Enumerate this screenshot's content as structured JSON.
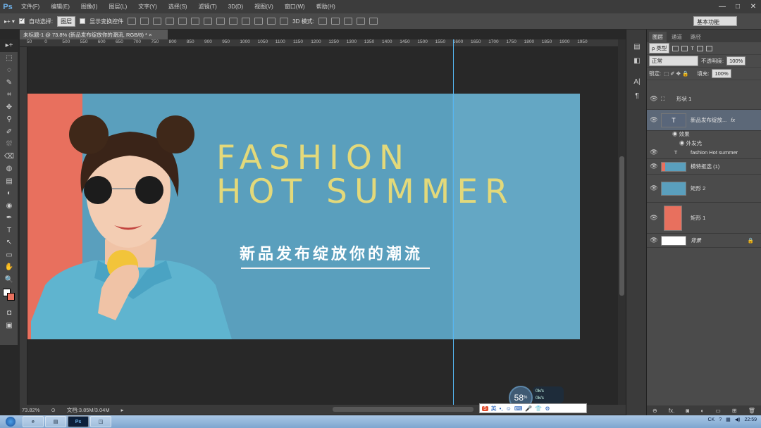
{
  "menubar": {
    "logo": "Ps",
    "items": [
      "文件(F)",
      "编辑(E)",
      "图像(I)",
      "图层(L)",
      "文字(Y)",
      "选择(S)",
      "滤镜(T)",
      "3D(D)",
      "视图(V)",
      "窗口(W)",
      "帮助(H)"
    ],
    "window_buttons": [
      "—",
      "□",
      "✕"
    ]
  },
  "options": {
    "auto_select_label": "自动选择:",
    "auto_select_value": "图层",
    "show_transform_label": "显示变换控件",
    "mode_3d_label": "3D 模式:",
    "workspace": "基本功能"
  },
  "document": {
    "tab_title": "未标题-1 @ 73.8% (新品发布绽放你的潮流, RGB/8) *",
    "tab_close": "×",
    "zoom": "73.82%",
    "doc_info": "文档:3.85M/3.04M"
  },
  "ruler": {
    "ticks": [
      "50",
      "0",
      "500",
      "550",
      "600",
      "650",
      "700",
      "750",
      "800",
      "850",
      "900",
      "950",
      "1000",
      "1050",
      "1100",
      "1150",
      "1200",
      "1250",
      "1300",
      "1350",
      "1400",
      "1450",
      "1500",
      "1550",
      "1600",
      "1650",
      "1700",
      "1750",
      "1800",
      "1850",
      "1900",
      "1950"
    ]
  },
  "tools": [
    "▸+",
    "⬚",
    "◌",
    "✎",
    "⌗",
    "✥",
    "⚲",
    "✐",
    "⛆",
    "⌫",
    "◍",
    "▤",
    "◐",
    "◉",
    "✒",
    "T",
    "↖",
    "▭",
    "✋",
    "🔍"
  ],
  "poster": {
    "title_line1": "FASHION",
    "title_line2": "HOT SUMMER",
    "subtitle": "新品发布绽放你的潮流",
    "background_color": "#5a9fbd",
    "accent_color": "#e8705e",
    "title_color": "#e3d97a"
  },
  "layers_panel": {
    "tabs": [
      "图层",
      "通道",
      "路径"
    ],
    "filter_label": "ρ 类型",
    "blend_mode": "正常",
    "opacity_label": "不透明度:",
    "opacity_value": "100%",
    "lock_label": "锁定:",
    "fill_label": "填充:",
    "fill_value": "100%",
    "layers": [
      {
        "name": "形状 1",
        "kind": "shape"
      },
      {
        "name": "新品发布绽放...",
        "kind": "text",
        "fx": "fx",
        "selected": true
      },
      {
        "name": "fashion Hot summer",
        "kind": "text"
      },
      {
        "name": "模特抠选 (1)",
        "kind": "image"
      },
      {
        "name": "矩形 2",
        "kind": "rect-blue"
      },
      {
        "name": "矩形 1",
        "kind": "rect-coral"
      },
      {
        "name": "背景",
        "kind": "background",
        "locked": true
      }
    ],
    "effects_label": "效果",
    "outer_glow_label": "外发光"
  },
  "taskbar": {
    "clock": "22:59",
    "tray_lang": "CK"
  },
  "overlay": {
    "meter_value": "58",
    "meter_unit": "%",
    "net_up": "0k/s",
    "net_down": "0k/s",
    "ime_label": "英"
  }
}
